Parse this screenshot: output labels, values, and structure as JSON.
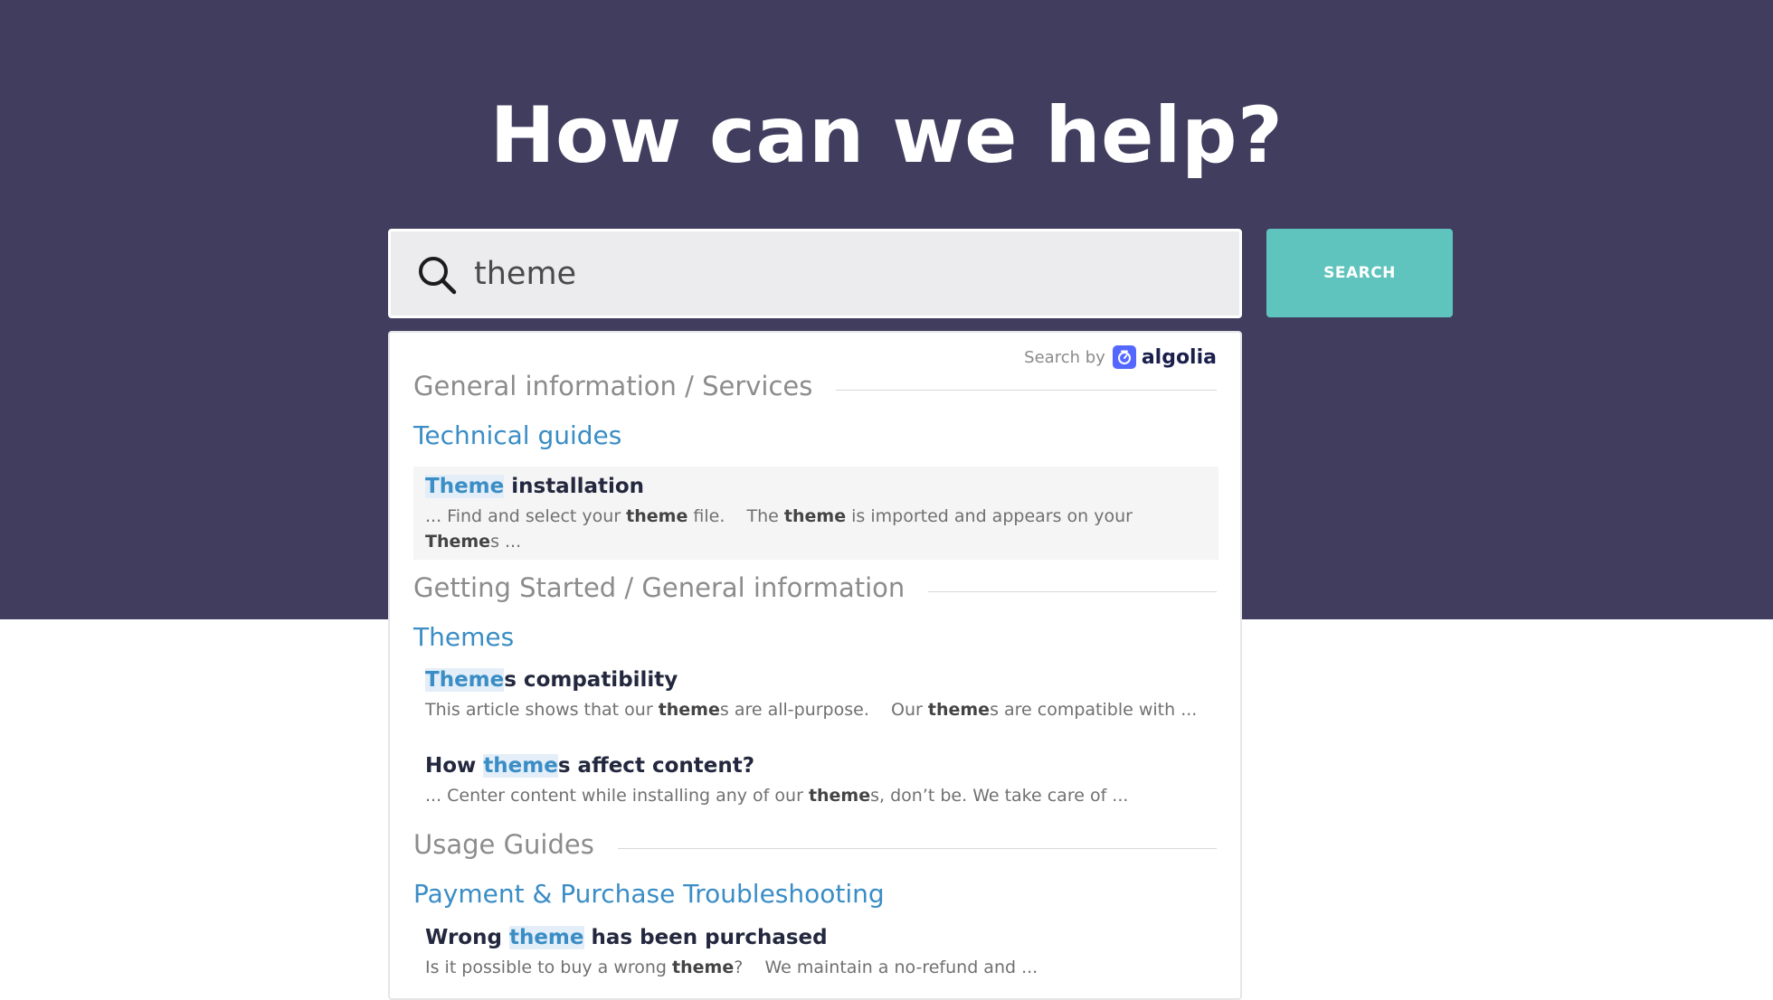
{
  "hero": {
    "title": "How can we help?"
  },
  "search": {
    "value": "theme",
    "button_label": "SEARCH"
  },
  "powered_by": {
    "label": "Search by",
    "brand": "algolia"
  },
  "colors": {
    "hero_bg": "#403d5e",
    "accent": "#5fc4bd",
    "link": "#3a8dc5",
    "algolia_brand": "#5468ff"
  },
  "results": {
    "groups": [
      {
        "category": "General information / Services",
        "subcategory": "Technical guides",
        "hits": [
          {
            "title_parts": [
              {
                "t": "Theme",
                "hl": true
              },
              {
                "t": " installation",
                "hl": false
              }
            ],
            "snippet_parts": [
              {
                "t": "... Find and select your ",
                "b": false
              },
              {
                "t": "theme",
                "b": true
              },
              {
                "t": " file.    The ",
                "b": false
              },
              {
                "t": "theme",
                "b": true
              },
              {
                "t": " is imported and appears on your ",
                "b": false
              },
              {
                "t": "Theme",
                "b": true
              },
              {
                "t": "s ...",
                "b": false
              }
            ],
            "active": true
          }
        ]
      },
      {
        "category": "Getting Started / General information",
        "subcategory": "Themes",
        "hits": [
          {
            "title_parts": [
              {
                "t": "Theme",
                "hl": true
              },
              {
                "t": "s compatibility",
                "hl": false
              }
            ],
            "snippet_parts": [
              {
                "t": "This article shows that our ",
                "b": false
              },
              {
                "t": "theme",
                "b": true
              },
              {
                "t": "s are all-purpose.    Our ",
                "b": false
              },
              {
                "t": "theme",
                "b": true
              },
              {
                "t": "s are compatible with ...",
                "b": false
              }
            ],
            "active": false
          },
          {
            "title_parts": [
              {
                "t": "How ",
                "hl": false
              },
              {
                "t": "theme",
                "hl": true
              },
              {
                "t": "s affect content?",
                "hl": false
              }
            ],
            "snippet_parts": [
              {
                "t": "... Center content while installing any of our ",
                "b": false
              },
              {
                "t": "theme",
                "b": true
              },
              {
                "t": "s, don’t be. We take care of ...",
                "b": false
              }
            ],
            "active": false
          }
        ]
      },
      {
        "category": "Usage Guides",
        "subcategory": "Payment & Purchase Troubleshooting",
        "hits": [
          {
            "title_parts": [
              {
                "t": "Wrong ",
                "hl": false
              },
              {
                "t": "theme",
                "hl": true
              },
              {
                "t": " has been purchased",
                "hl": false
              }
            ],
            "snippet_parts": [
              {
                "t": "Is it possible to buy a wrong ",
                "b": false
              },
              {
                "t": "theme",
                "b": true
              },
              {
                "t": "?    We maintain a no-refund and ...",
                "b": false
              }
            ],
            "active": false
          }
        ]
      }
    ]
  }
}
